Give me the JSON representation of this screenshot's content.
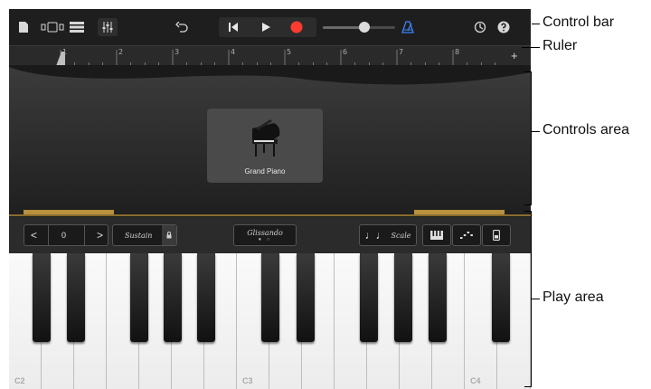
{
  "ruler": {
    "bars": [
      "1",
      "2",
      "3",
      "4",
      "5",
      "6",
      "7",
      "8"
    ],
    "add_symbol": "+"
  },
  "instrument": {
    "name": "Grand Piano"
  },
  "keyboard_controls": {
    "octave_down": "<",
    "octave_value": "0",
    "octave_up": ">",
    "sustain_label": "Sustain",
    "glissando_label": "Glissando",
    "scale_label": "Scale"
  },
  "key_labels": [
    "C2",
    "C3",
    "C4"
  ],
  "callouts": {
    "control_bar": "Control bar",
    "ruler": "Ruler",
    "controls_area": "Controls area",
    "play_area": "Play area"
  },
  "colors": {
    "record": "#ff3b30",
    "metronome": "#3b82f6",
    "gold": "#b8913e"
  },
  "icons": [
    "document-icon",
    "browser-view-icon",
    "tracks-view-icon",
    "mixer-icon",
    "undo-icon",
    "go-to-beginning-icon",
    "play-icon",
    "record-icon",
    "metronome-icon",
    "settings-icon",
    "help-icon",
    "lock-icon",
    "note-icon",
    "keyboard-icon",
    "arpeggiator-icon",
    "phone-icon",
    "grand-piano-icon"
  ]
}
